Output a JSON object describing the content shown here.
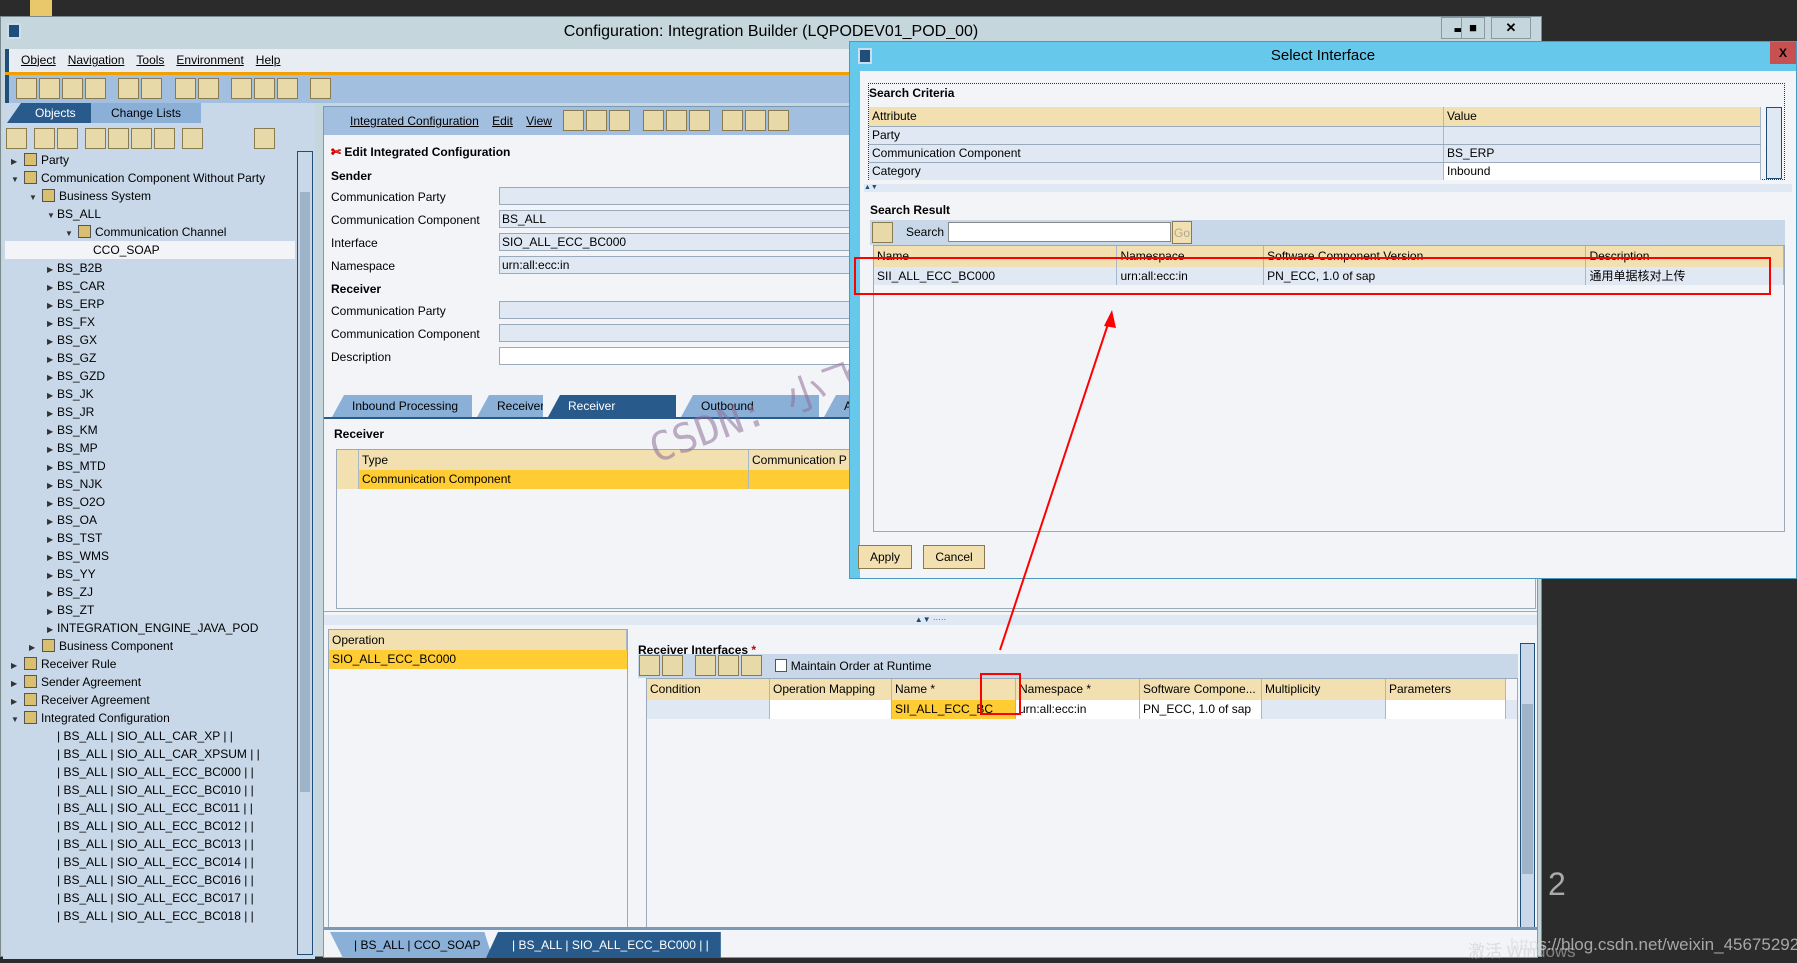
{
  "window": {
    "title": "Configuration: Integration Builder (LQPODEV01_POD_00)",
    "minimize": "▬",
    "maximize": "■",
    "close": "✕"
  },
  "menu": [
    "Object",
    "Navigation",
    "Tools",
    "Environment",
    "Help"
  ],
  "left": {
    "tabs": [
      "Objects",
      "Change Lists"
    ],
    "tree": [
      {
        "label": "Party",
        "level": 0,
        "exp": "right",
        "icon": "party-icon"
      },
      {
        "label": "Communication Component Without Party",
        "level": 0,
        "exp": "down",
        "icon": "component-icon"
      },
      {
        "label": "Business System",
        "level": 1,
        "exp": "down",
        "icon": "business-system-icon"
      },
      {
        "label": "BS_ALL",
        "level": 2,
        "exp": "down"
      },
      {
        "label": "Communication Channel",
        "level": 3,
        "exp": "down",
        "icon": "channel-icon"
      },
      {
        "label": "CCO_SOAP",
        "level": 4,
        "exp": ""
      },
      {
        "label": "BS_B2B",
        "level": 2,
        "exp": "right"
      },
      {
        "label": "BS_CAR",
        "level": 2,
        "exp": "right"
      },
      {
        "label": "BS_ERP",
        "level": 2,
        "exp": "right"
      },
      {
        "label": "BS_FX",
        "level": 2,
        "exp": "right"
      },
      {
        "label": "BS_GX",
        "level": 2,
        "exp": "right"
      },
      {
        "label": "BS_GZ",
        "level": 2,
        "exp": "right"
      },
      {
        "label": "BS_GZD",
        "level": 2,
        "exp": "right"
      },
      {
        "label": "BS_JK",
        "level": 2,
        "exp": "right"
      },
      {
        "label": "BS_JR",
        "level": 2,
        "exp": "right"
      },
      {
        "label": "BS_KM",
        "level": 2,
        "exp": "right"
      },
      {
        "label": "BS_MP",
        "level": 2,
        "exp": "right"
      },
      {
        "label": "BS_MTD",
        "level": 2,
        "exp": "right"
      },
      {
        "label": "BS_NJK",
        "level": 2,
        "exp": "right"
      },
      {
        "label": "BS_O2O",
        "level": 2,
        "exp": "right"
      },
      {
        "label": "BS_OA",
        "level": 2,
        "exp": "right"
      },
      {
        "label": "BS_TST",
        "level": 2,
        "exp": "right"
      },
      {
        "label": "BS_WMS",
        "level": 2,
        "exp": "right"
      },
      {
        "label": "BS_YY",
        "level": 2,
        "exp": "right"
      },
      {
        "label": "BS_ZJ",
        "level": 2,
        "exp": "right"
      },
      {
        "label": "BS_ZT",
        "level": 2,
        "exp": "right"
      },
      {
        "label": "INTEGRATION_ENGINE_JAVA_POD",
        "level": 2,
        "exp": "right"
      },
      {
        "label": "Business Component",
        "level": 1,
        "exp": "right",
        "icon": "business-component-icon"
      },
      {
        "label": "Receiver Rule",
        "level": 0,
        "exp": "right",
        "icon": "receiver-rule-icon"
      },
      {
        "label": "Sender Agreement",
        "level": 0,
        "exp": "right",
        "icon": "sender-agreement-icon"
      },
      {
        "label": "Receiver Agreement",
        "level": 0,
        "exp": "right",
        "icon": "receiver-agreement-icon"
      },
      {
        "label": "Integrated Configuration",
        "level": 0,
        "exp": "down",
        "icon": "integrated-config-icon"
      },
      {
        "label": "| BS_ALL | SIO_ALL_CAR_XP |  |",
        "level": 2,
        "exp": ""
      },
      {
        "label": "| BS_ALL | SIO_ALL_CAR_XPSUM |  |",
        "level": 2,
        "exp": ""
      },
      {
        "label": "| BS_ALL | SIO_ALL_ECC_BC000 |  |",
        "level": 2,
        "exp": ""
      },
      {
        "label": "| BS_ALL | SIO_ALL_ECC_BC010 |  |",
        "level": 2,
        "exp": ""
      },
      {
        "label": "| BS_ALL | SIO_ALL_ECC_BC011 |  |",
        "level": 2,
        "exp": ""
      },
      {
        "label": "| BS_ALL | SIO_ALL_ECC_BC012 |  |",
        "level": 2,
        "exp": ""
      },
      {
        "label": "| BS_ALL | SIO_ALL_ECC_BC013 |  |",
        "level": 2,
        "exp": ""
      },
      {
        "label": "| BS_ALL | SIO_ALL_ECC_BC014 |  |",
        "level": 2,
        "exp": ""
      },
      {
        "label": "| BS_ALL | SIO_ALL_ECC_BC016 |  |",
        "level": 2,
        "exp": ""
      },
      {
        "label": "| BS_ALL | SIO_ALL_ECC_BC017 |  |",
        "level": 2,
        "exp": ""
      },
      {
        "label": "| BS_ALL | SIO_ALL_ECC_BC018 |  |",
        "level": 2,
        "exp": ""
      }
    ]
  },
  "editor": {
    "menu": [
      "Integrated Configuration",
      "Edit",
      "View"
    ],
    "heading": "Edit Integrated Configuration",
    "sender": {
      "title": "Sender",
      "fields": [
        {
          "label": "Communication Party",
          "value": ""
        },
        {
          "label": "Communication Component",
          "value": "BS_ALL"
        },
        {
          "label": "Interface",
          "value": "SIO_ALL_ECC_BC000"
        },
        {
          "label": "Namespace",
          "value": "urn:all:ecc:in"
        }
      ]
    },
    "receiver": {
      "title": "Receiver",
      "fields": [
        {
          "label": "Communication Party",
          "value": ""
        },
        {
          "label": "Communication Component",
          "value": ""
        },
        {
          "label": "Description",
          "value": ""
        }
      ]
    },
    "tabs": [
      "Inbound Processing",
      "Receiver",
      "Receiver Interfaces",
      "Outbound Processing",
      "As"
    ],
    "receiver_table": {
      "title": "Receiver",
      "headers": [
        "Type",
        "Communication P"
      ],
      "rows": [
        [
          "Communication Component",
          ""
        ]
      ]
    },
    "operation": {
      "header": "Operation",
      "rows": [
        "SIO_ALL_ECC_BC000"
      ]
    },
    "ri": {
      "title": "Receiver Interfaces",
      "required": "*",
      "maintain_order": "Maintain Order at Runtime",
      "headers": [
        "Condition",
        "Operation Mapping",
        "Name *",
        "Namespace *",
        "Software Compone...",
        "Multiplicity",
        "Parameters"
      ],
      "row": [
        "",
        "",
        "SII_ALL_ECC_BC",
        "urn:all:ecc:in",
        "PN_ECC, 1.0 of sap",
        "",
        ""
      ]
    },
    "bottom_tabs": [
      "| BS_ALL | CCO_SOAP",
      "| BS_ALL | SIO_ALL_ECC_BC000 |  |"
    ]
  },
  "dialog": {
    "title": "Select Interface",
    "close": "X",
    "criteria_title": "Search Criteria",
    "criteria_headers": [
      "Attribute",
      "Value"
    ],
    "criteria": [
      [
        "Party",
        ""
      ],
      [
        "Communication Component",
        "BS_ERP"
      ],
      [
        "Category",
        "Inbound"
      ]
    ],
    "result_title": "Search Result",
    "search_label": "Search",
    "search_value": "",
    "go": "Go",
    "result_headers": [
      "Name",
      "Namespace",
      "Software Component Version",
      "Description"
    ],
    "results": [
      [
        "SII_ALL_ECC_BC000",
        "urn:all:ecc:in",
        "PN_ECC, 1.0 of sap",
        "通用单据核对上传"
      ]
    ],
    "apply": "Apply",
    "cancel": "Cancel"
  },
  "watermark": "CSDN: 小飞猪猪猪猪猪猪",
  "overlay": {
    "activate": "激活 Windows",
    "url": "https://blog.csdn.net/weixin_45675292",
    "digit": "2"
  },
  "colors": {
    "highlight": "#ffcc33",
    "header": "#f2e0b0",
    "selected_tab": "#285a8c",
    "annotation": "#ff0000"
  }
}
